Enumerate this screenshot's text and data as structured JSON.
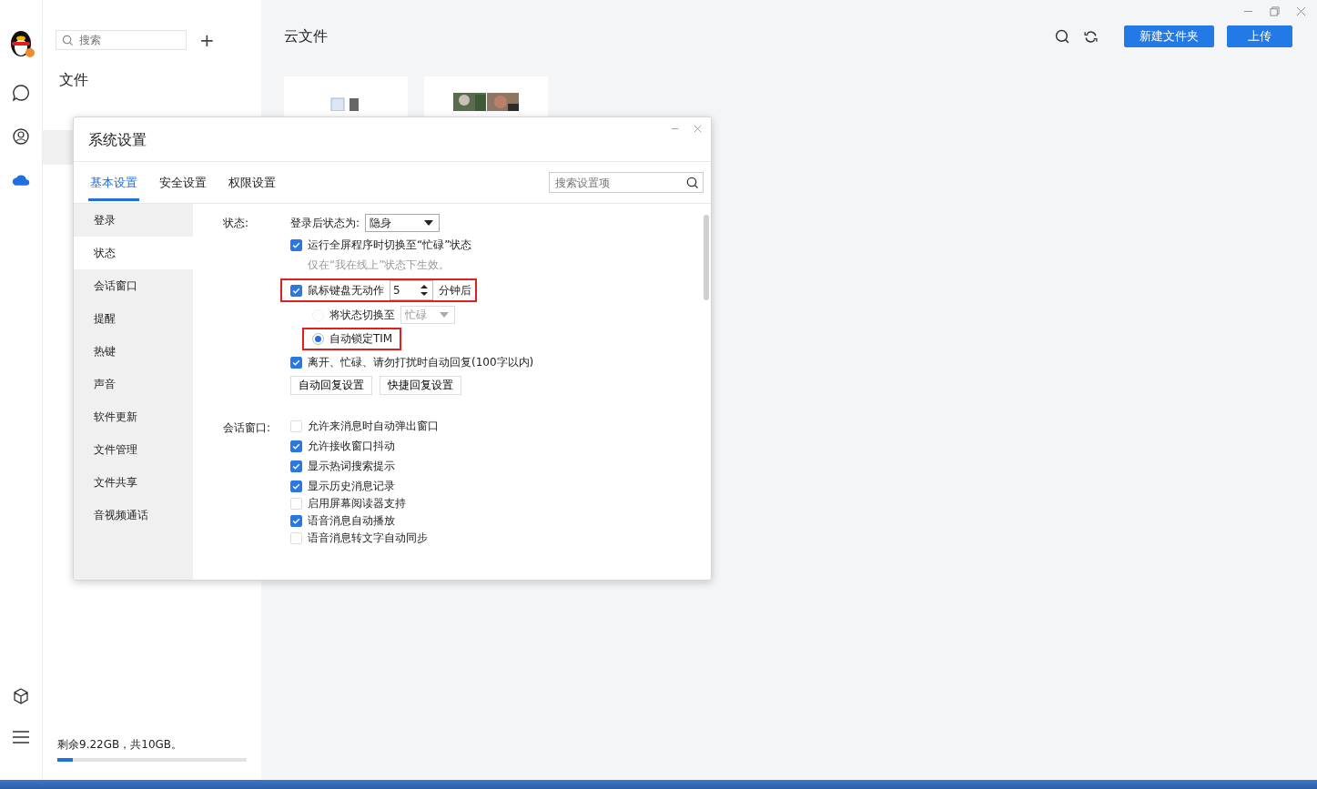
{
  "side_panel": {
    "search": {
      "placeholder": "搜索"
    },
    "add_label": "+",
    "heading": "文件",
    "storage": {
      "text": "剩余9.22GB，共10GB。",
      "level": 0.08
    }
  },
  "main": {
    "title": "云文件",
    "buttons": [
      {
        "label": "新建文件夹"
      },
      {
        "label": "上传"
      }
    ],
    "files": [
      {
        "kind": "document"
      },
      {
        "kind": "picture"
      }
    ]
  },
  "dialog": {
    "title": "系统设置",
    "tabs": [
      {
        "label": "基本设置",
        "selected": true
      },
      {
        "label": "安全设置",
        "selected": false
      },
      {
        "label": "权限设置",
        "selected": false
      }
    ],
    "search": {
      "placeholder": "搜索设置项"
    },
    "nav": [
      {
        "label": "登录",
        "selected": false
      },
      {
        "label": "状态",
        "selected": true
      },
      {
        "label": "会话窗口",
        "selected": false
      },
      {
        "label": "提醒",
        "selected": false
      },
      {
        "label": "热键",
        "selected": false
      },
      {
        "label": "声音",
        "selected": false
      },
      {
        "label": "软件更新",
        "selected": false
      },
      {
        "label": "文件管理",
        "selected": false
      },
      {
        "label": "文件共享",
        "selected": false
      },
      {
        "label": "音视频通话",
        "selected": false
      }
    ],
    "status_section": {
      "label": "状态:",
      "login_status": {
        "label": "登录后状态为:",
        "value": "隐身"
      },
      "fullscreen": {
        "label": "运行全屏程序时切换至“忙碌”状态",
        "checked": true
      },
      "hint": "仅在“我在线上”状态下生效。",
      "idle": {
        "label": "鼠标键盘无动作",
        "checked": true,
        "minutes": "5",
        "suffix": "分钟后",
        "highlighted": true
      },
      "switch_to": {
        "label": "将状态切换至",
        "selected": false,
        "value": "忙碌",
        "disabled": true
      },
      "lock": {
        "label": "自动锁定TIM",
        "selected": true,
        "highlighted": true
      },
      "auto_reply": {
        "label": "离开、忙碌、请勿打扰时自动回复(100字以内)",
        "checked": true
      },
      "buttons": [
        {
          "label": "自动回复设置"
        },
        {
          "label": "快捷回复设置"
        }
      ]
    },
    "chat_section": {
      "label": "会话窗口:",
      "options": [
        {
          "label": "允许来消息时自动弹出窗口",
          "checked": false
        },
        {
          "label": "允许接收窗口抖动",
          "checked": true
        },
        {
          "label": "显示热词搜索提示",
          "checked": true
        },
        {
          "label": "显示历史消息记录",
          "checked": true
        },
        {
          "label": "启用屏幕阅读器支持",
          "checked": false
        },
        {
          "label": "语音消息自动播放",
          "checked": true
        },
        {
          "label": "语音消息转文字自动同步",
          "checked": false
        }
      ]
    }
  }
}
